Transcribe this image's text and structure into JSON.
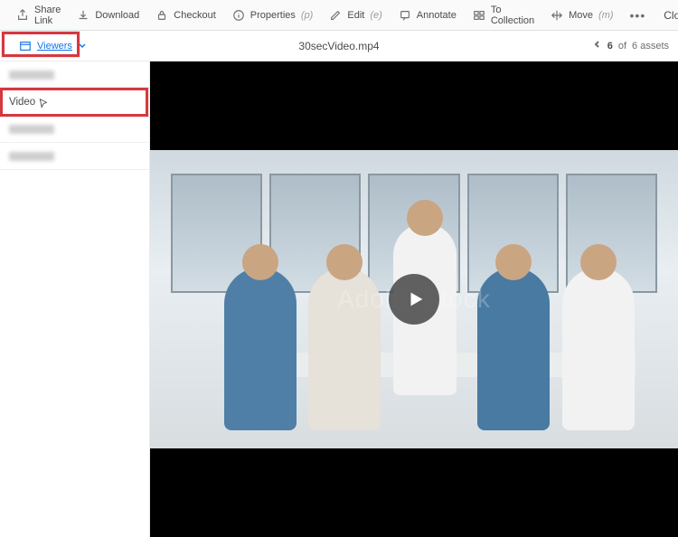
{
  "toolbar": {
    "shareLink": "Share Link",
    "download": "Download",
    "checkout": "Checkout",
    "properties": "Properties",
    "propertiesHint": "(p)",
    "edit": "Edit",
    "editHint": "(e)",
    "annotate": "Annotate",
    "toCollection": "To Collection",
    "move": "Move",
    "moveHint": "(m)",
    "more": "•••",
    "close": "Close"
  },
  "secondary": {
    "viewers": "Viewers",
    "filename": "30secVideo.mp4",
    "assetCurrent": "6",
    "assetOf": "of",
    "assetTotal": "6 assets"
  },
  "sidebar": {
    "items": [
      {
        "label": "",
        "blurred": true
      },
      {
        "label": "Video",
        "blurred": false
      },
      {
        "label": "",
        "blurred": true
      },
      {
        "label": "",
        "blurred": true
      }
    ]
  },
  "viewer": {
    "watermark": "Adobe Stock"
  }
}
